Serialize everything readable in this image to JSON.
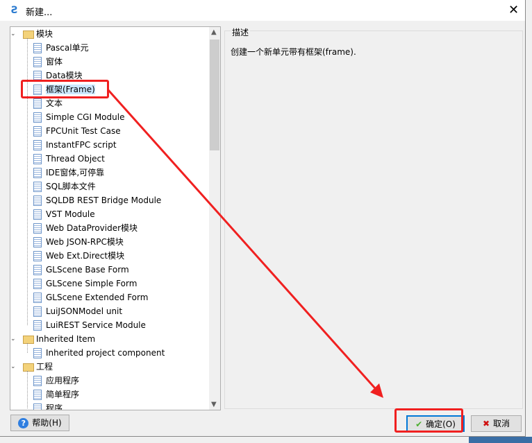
{
  "window": {
    "title": "新建...",
    "close": "✕"
  },
  "tree": {
    "groups": [
      {
        "label": "模块",
        "items": [
          "Pascal单元",
          "窗体",
          "Data模块",
          "框架(Frame)",
          "文本",
          "Simple CGI Module",
          "FPCUnit Test Case",
          "InstantFPC script",
          "Thread Object",
          "IDE窗体,可停靠",
          "SQL脚本文件",
          "SQLDB REST Bridge Module",
          "VST Module",
          "Web DataProvider模块",
          "Web JSON-RPC模块",
          "Web Ext.Direct模块",
          "GLScene Base Form",
          "GLScene Simple Form",
          "GLScene Extended Form",
          "LuiJSONModel unit",
          "LuiREST Service Module"
        ]
      },
      {
        "label": "Inherited Item",
        "items": [
          "Inherited project component"
        ]
      },
      {
        "label": "工程",
        "items": [
          "应用程序",
          "简单程序",
          "程序"
        ]
      }
    ],
    "selected": "框架(Frame)"
  },
  "description": {
    "label": "描述",
    "text": "创建一个新单元带有框架(frame)."
  },
  "buttons": {
    "help": "帮助(H)",
    "ok": "确定(O)",
    "cancel": "取消"
  },
  "colors": {
    "selection": "#cce8ff",
    "annotation": "#f02020",
    "accent": "#0078d7"
  }
}
